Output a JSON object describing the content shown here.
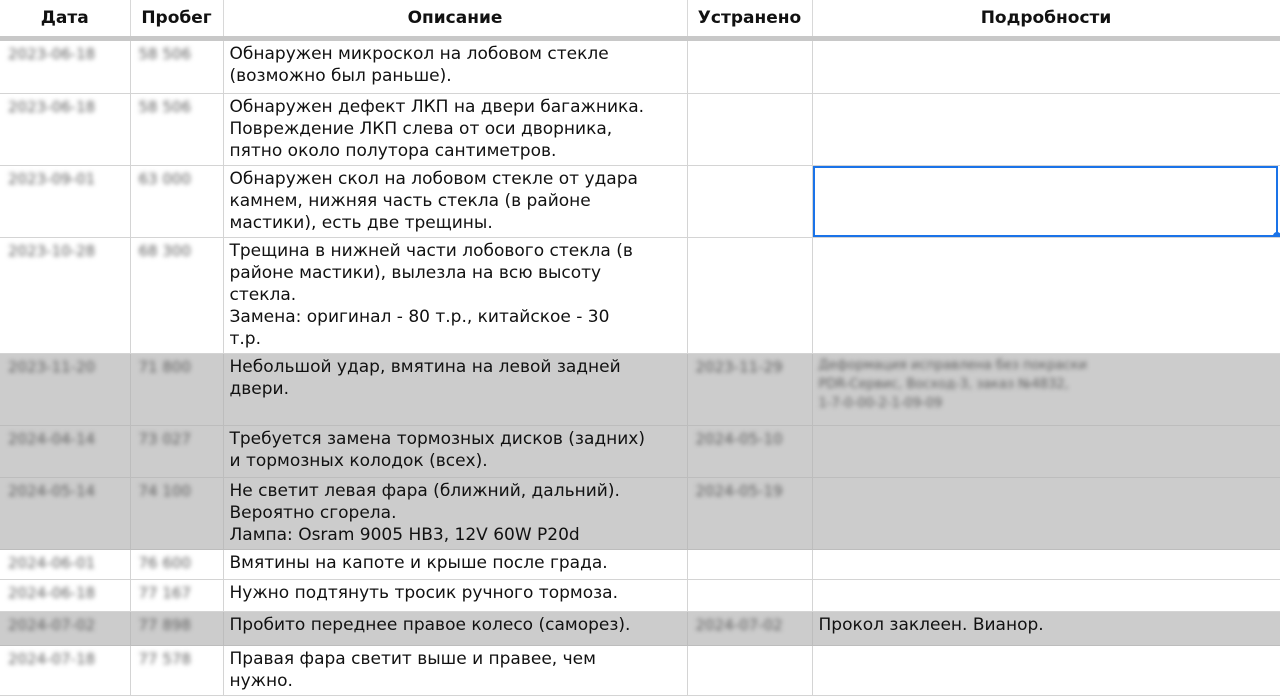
{
  "table": {
    "headers": [
      "Дата",
      "Пробег",
      "Описание",
      "Устранено",
      "Подробности"
    ],
    "rows": [
      {
        "date": "2023-06-18",
        "mileage": "58 506",
        "description": "Обнаружен микроскол на лобовом стекле\n(возможно был раньше).",
        "fixed": "",
        "details": "",
        "shaded": false
      },
      {
        "date": "2023-06-18",
        "mileage": "58 506",
        "description": "Обнаружен дефект ЛКП на двери багажника.\nПовреждение ЛКП слева от оси дворника,\nпятно около полутора сантиметров.",
        "fixed": "",
        "details": "",
        "shaded": false
      },
      {
        "date": "2023-09-01",
        "mileage": "63 000",
        "description": "Обнаружен скол на лобовом стекле от удара\nкамнем, нижняя часть стекла (в районе\nмастики), есть две трещины.",
        "fixed": "",
        "details": "",
        "shaded": false,
        "selected_details": true
      },
      {
        "date": "2023-10-28",
        "mileage": "68 300",
        "description": "Трещина в нижней части лобового стекла (в\nрайоне мастики), вылезла на всю высоту\nстекла.\nЗамена: оригинал - 80 т.р., китайское - 30\nт.р.",
        "fixed": "",
        "details": "",
        "shaded": false
      },
      {
        "date": "2023-11-20",
        "mileage": "71 800",
        "description": "Небольшой удар, вмятина на левой задней\nдвери.",
        "fixed": "2023-11-29",
        "details": "Деформация исправлена без покраски\nPDR-Сервис, Восход-3, заказ №4832,\n1-7-0-00-2-1-09-09",
        "shaded": true,
        "details_blurred": true
      },
      {
        "date": "2024-04-14",
        "mileage": "73 027",
        "description": "Требуется замена тормозных дисков (задних)\nи тормозных колодок (всех).",
        "fixed": "2024-05-10",
        "details": "",
        "shaded": true
      },
      {
        "date": "2024-05-14",
        "mileage": "74 100",
        "description": "Не светит левая фара (ближний, дальний).\nВероятно сгорела.\nЛампа: Osram 9005 HB3, 12V 60W P20d",
        "fixed": "2024-05-19",
        "details": "",
        "shaded": true
      },
      {
        "date": "2024-06-01",
        "mileage": "76 600",
        "description": "Вмятины на капоте и крыше после града.",
        "fixed": "",
        "details": "",
        "shaded": false
      },
      {
        "date": "2024-06-18",
        "mileage": "77 167",
        "description": "Нужно подтянуть тросик ручного тормоза.",
        "fixed": "",
        "details": "",
        "shaded": false
      },
      {
        "date": "2024-07-02",
        "mileage": "77 898",
        "description": "Пробито переднее правое колесо (саморез).",
        "fixed": "2024-07-02",
        "details": "Прокол заклеен. Вианор.",
        "shaded": true
      },
      {
        "date": "2024-07-18",
        "mileage": "77 578",
        "description": "Правая фара светит выше и правее, чем\nнужно.",
        "fixed": "",
        "details": "",
        "shaded": false
      }
    ]
  },
  "colors": {
    "shaded_row": "#cccccc",
    "selection": "#1a73e8",
    "header_gap": "#c8c8c8"
  }
}
